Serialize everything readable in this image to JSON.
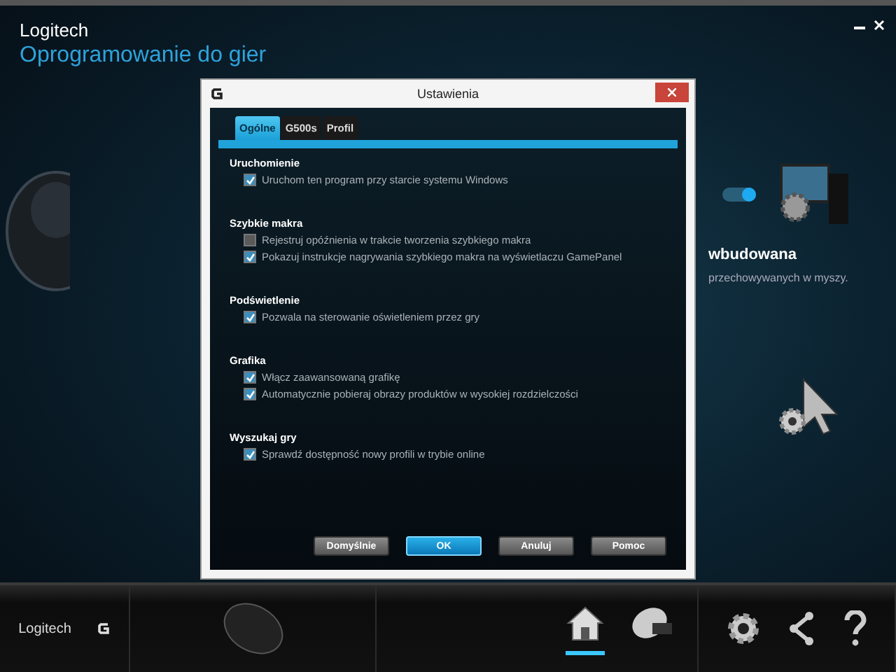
{
  "app": {
    "brand": "Logitech",
    "title": "Oprogramowanie do gier"
  },
  "background": {
    "toggle_on": true,
    "heading": "wbudowana",
    "text": "przechowywanych w myszy."
  },
  "dialog": {
    "title": "Ustawienia",
    "tabs": [
      {
        "label": "Ogólne",
        "selected": true
      },
      {
        "label": "G500s",
        "selected": false
      },
      {
        "label": "Profil",
        "selected": false
      }
    ],
    "sections": [
      {
        "title": "Uruchomienie",
        "options": [
          {
            "label": "Uruchom ten program przy starcie systemu Windows",
            "checked": true
          }
        ]
      },
      {
        "title": "Szybkie makra",
        "options": [
          {
            "label": "Rejestruj opóźnienia w trakcie tworzenia szybkiego makra",
            "checked": false
          },
          {
            "label": "Pokazuj instrukcje nagrywania szybkiego makra na wyświetlaczu GamePanel",
            "checked": true
          }
        ]
      },
      {
        "title": "Podświetlenie",
        "options": [
          {
            "label": "Pozwala na sterowanie oświetleniem przez gry",
            "checked": true
          }
        ]
      },
      {
        "title": "Grafika",
        "options": [
          {
            "label": "Włącz zaawansowaną grafikę",
            "checked": true
          },
          {
            "label": "Automatycznie pobieraj obrazy produktów w wysokiej rozdzielczości",
            "checked": true
          }
        ]
      },
      {
        "title": "Wyszukaj gry",
        "options": [
          {
            "label": "Sprawdź dostępność nowy profili w trybie online",
            "checked": true
          }
        ]
      }
    ],
    "buttons": [
      {
        "label": "Domyślnie",
        "selected": false
      },
      {
        "label": "OK",
        "selected": true
      },
      {
        "label": "Anuluj",
        "selected": false
      },
      {
        "label": "Pomoc",
        "selected": false
      }
    ]
  },
  "footer": {
    "brand": "Logitech",
    "nav": [
      {
        "kind": "home",
        "selected": true
      },
      {
        "kind": "memory",
        "selected": false
      }
    ]
  }
}
